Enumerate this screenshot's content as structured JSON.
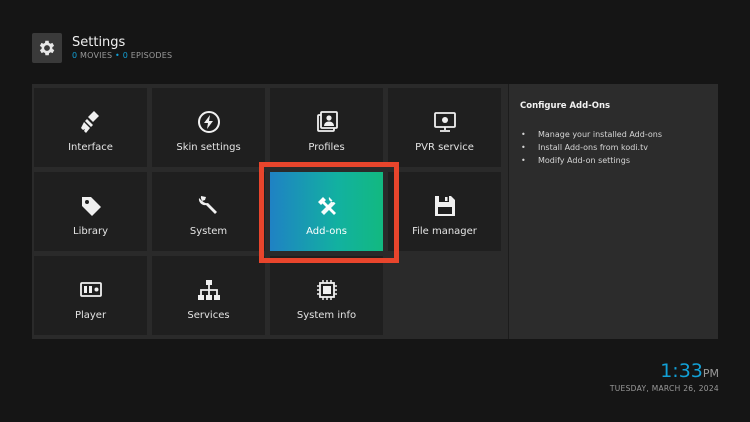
{
  "header": {
    "title": "Settings",
    "movies_count": "0",
    "movies_label": "MOVIES",
    "separator": "•",
    "episodes_count": "0",
    "episodes_label": "EPISODES",
    "icon": "gear-icon"
  },
  "tiles": [
    {
      "label": "Interface",
      "icon": "paintbrush-icon"
    },
    {
      "label": "Skin settings",
      "icon": "skin-icon"
    },
    {
      "label": "Profiles",
      "icon": "profiles-icon"
    },
    {
      "label": "PVR service",
      "icon": "pvr-icon"
    },
    {
      "label": "Library",
      "icon": "tag-icon"
    },
    {
      "label": "System",
      "icon": "wrench-icon"
    },
    {
      "label": "Add-ons",
      "icon": "tools-icon",
      "focused": true
    },
    {
      "label": "File manager",
      "icon": "floppy-icon"
    },
    {
      "label": "Player",
      "icon": "player-icon"
    },
    {
      "label": "Services",
      "icon": "network-icon"
    },
    {
      "label": "System info",
      "icon": "chip-icon"
    }
  ],
  "info": {
    "title": "Configure Add-Ons",
    "bullet": "•",
    "items": [
      "Manage your installed Add-ons",
      "Install Add-ons from kodi.tv",
      "Modify Add-on settings"
    ]
  },
  "clock": {
    "time": "1:33",
    "ampm": "PM",
    "date": "TUESDAY, MARCH 26, 2024"
  },
  "colors": {
    "accent": "#12a0d6",
    "focus_ring": "#e8452c",
    "focus_gradient_start": "#1f82c4",
    "focus_gradient_end": "#12b980"
  }
}
